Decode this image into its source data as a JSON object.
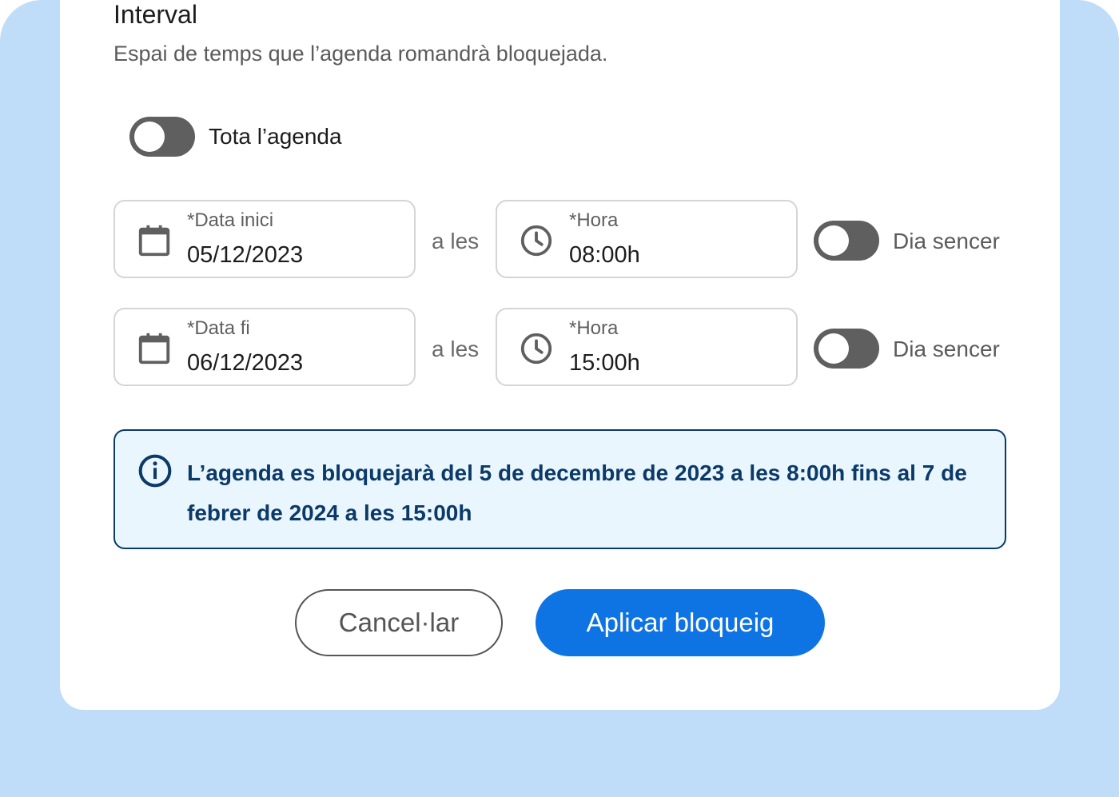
{
  "section": {
    "title": "Interval",
    "subtitle": "Espai de temps que l’agenda romandrà bloquejada."
  },
  "whole_agenda": {
    "label": "Tota l’agenda",
    "on": false
  },
  "start": {
    "date_label": "*Data inici",
    "date_value": "05/12/2023",
    "connector": "a les",
    "time_label": "*Hora",
    "time_value": "08:00h",
    "full_day_label": "Dia sencer",
    "full_day_on": false
  },
  "end": {
    "date_label": "*Data fi",
    "date_value": "06/12/2023",
    "connector": "a les",
    "time_label": "*Hora",
    "time_value": "15:00h",
    "full_day_label": "Dia sencer",
    "full_day_on": false
  },
  "info": {
    "message": "L’agenda es bloquejarà del 5 de decembre de 2023 a les 8:00h fins al 7 de febrer de 2024 a les 15:00h",
    "icon": "info-icon"
  },
  "actions": {
    "cancel_label": "Cancel·lar",
    "apply_label": "Aplicar bloqueig"
  },
  "colors": {
    "background": "#bfdcf8",
    "toggle_off": "#5f5f5f",
    "info_bg": "#eaf6fd",
    "info_text": "#0c3a68",
    "primary": "#0e74e4"
  }
}
